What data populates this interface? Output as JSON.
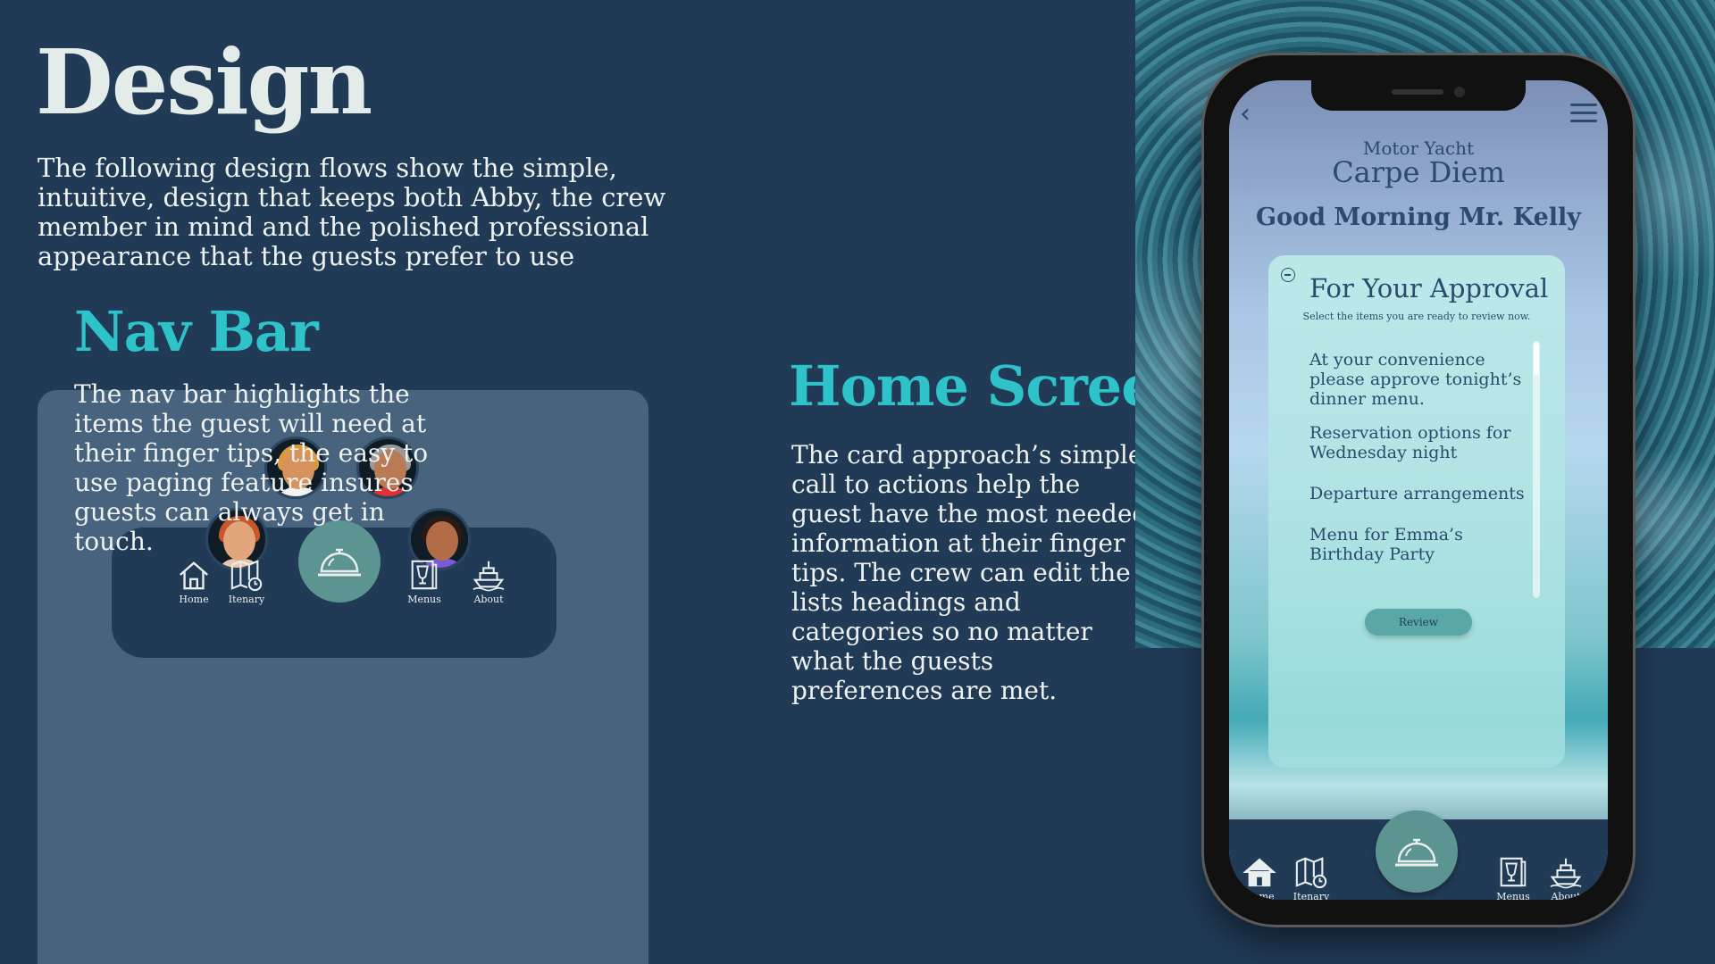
{
  "page": {
    "title": "Design",
    "intro": "The following design flows show the simple, intuitive, design that keeps both Abby, the crew member in mind and the polished professional appearance that the guests prefer to use"
  },
  "nav_section": {
    "heading": "Nav Bar",
    "description": "The nav bar highlights the items the guest will need at their finger tips, the easy to use paging feature insures guests can always get in touch.",
    "items": [
      {
        "label": "Home",
        "icon": "home-icon"
      },
      {
        "label": "Itenary",
        "icon": "map-clock-icon"
      },
      {
        "label": "",
        "icon": "service-bell-icon"
      },
      {
        "label": "Menus",
        "icon": "menu-wine-icon"
      },
      {
        "label": "About",
        "icon": "yacht-icon"
      }
    ],
    "avatars": [
      "crew-avatar-blonde",
      "crew-avatar-bearded",
      "crew-avatar-redhead",
      "crew-avatar-boy"
    ]
  },
  "home_section": {
    "heading": "Home Screen",
    "description": "The card approach’s simple call to actions help the guest have the most needed information at their finger tips. The crew can edit the lists headings and categories so no matter what the guests preferences are met."
  },
  "phone": {
    "yacht_type": "Motor Yacht",
    "yacht_name": "Carpe Diem",
    "greeting": "Good Morning Mr. Kelly",
    "card": {
      "title": "For Your Approval",
      "subtitle": "Select the items you are ready to review now.",
      "items": [
        "At your convenience please approve tonight’s dinner menu.",
        "Reservation options for Wednesday night",
        "Departure arrangements",
        "Menu for Emma’s Birthday Party"
      ],
      "button": "Review"
    },
    "nav": [
      {
        "label": "Home",
        "icon": "home-icon"
      },
      {
        "label": "Itenary",
        "icon": "map-clock-icon"
      },
      {
        "label": "",
        "icon": "service-bell-icon"
      },
      {
        "label": "Menus",
        "icon": "menu-wine-icon"
      },
      {
        "label": "About",
        "icon": "yacht-icon"
      }
    ]
  },
  "colors": {
    "background": "#213b57",
    "panel": "#47637d",
    "accent": "#2ec3c9",
    "bell": "#5b9490"
  }
}
